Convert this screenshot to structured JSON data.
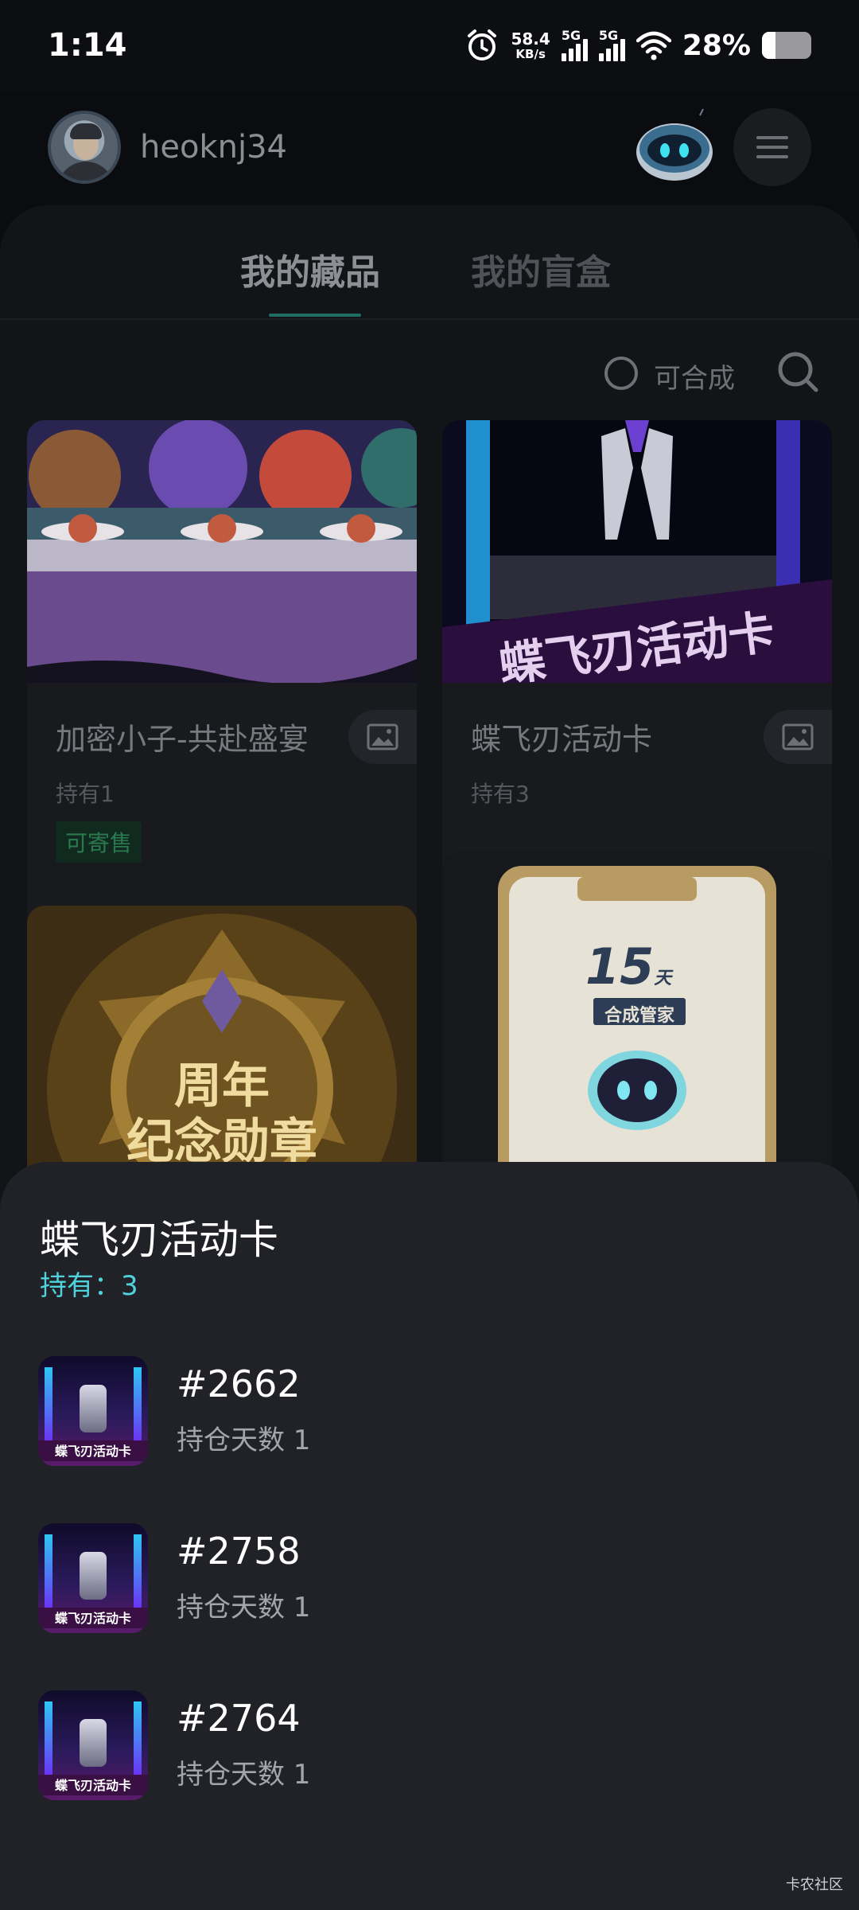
{
  "status_bar": {
    "time": "1:14",
    "net_speed_value": "58.4",
    "net_speed_unit": "KB/s",
    "signal_1_label": "5G",
    "signal_2_label": "5G",
    "battery_text": "28%",
    "battery_level": 0.28,
    "icons": [
      "alarm-icon",
      "signal-icon",
      "wifi-icon",
      "battery-icon"
    ]
  },
  "header": {
    "username": "heoknj34"
  },
  "tabs": [
    {
      "label": "我的藏品",
      "active": true
    },
    {
      "label": "我的盲盒",
      "active": false
    }
  ],
  "filter": {
    "composable_label": "可合成"
  },
  "cards": [
    {
      "title": "加密小子-共赴盛宴",
      "owned": "持有1",
      "tag": "可寄售"
    },
    {
      "title": "蝶飞刃活动卡",
      "owned": "持有3",
      "image_text": "蝶飞刃活动卡"
    },
    {
      "image_text_line1": "周年",
      "image_text_line2": "纪念勋章"
    },
    {
      "image_number": "15",
      "image_unit": "天",
      "image_caption": "合成管家"
    }
  ],
  "sheet": {
    "title": "蝶飞刃活动卡",
    "owned": "持有：3",
    "thumb_text": "蝶飞刃活动卡",
    "items": [
      {
        "id": "#2662",
        "days": "持仓天数 1"
      },
      {
        "id": "#2758",
        "days": "持仓天数 1"
      },
      {
        "id": "#2764",
        "days": "持仓天数 1"
      }
    ]
  },
  "watermark": "卡农社区",
  "colors": {
    "accent_cyan": "#4fd2db",
    "tab_underline": "#1f6e61",
    "tag_green": "#2b7a4e"
  }
}
